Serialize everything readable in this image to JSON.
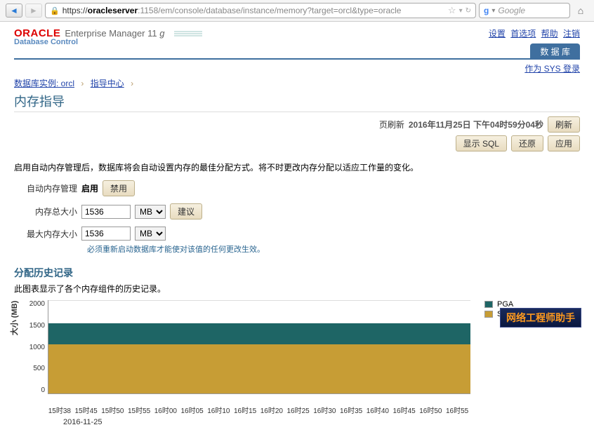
{
  "browser": {
    "url_prefix": "https://",
    "url_host": "oracleserver",
    "url_path": ":1158/em/console/database/instance/memory?target=orcl&type=oracle",
    "search_placeholder": "Google"
  },
  "header": {
    "logo": "ORACLE",
    "product": "Enterprise Manager 11",
    "product_suffix": "g",
    "subtitle": "Database Control",
    "links": [
      "设置",
      "首选项",
      "帮助",
      "注销"
    ],
    "tab_label": "数 据 库",
    "login_as": "作为 SYS 登录"
  },
  "breadcrumb": {
    "items": [
      "数据库实例: orcl",
      "指导中心"
    ]
  },
  "title": "内存指导",
  "refresh": {
    "label": "页刷新",
    "timestamp": "2016年11月25日  下午04时59分04秒",
    "btn_refresh": "刷新",
    "btn_sql": "显示 SQL",
    "btn_restore": "还原",
    "btn_apply": "应用"
  },
  "desc": "启用自动内存管理后，数据库将会自动设置内存的最佳分配方式。将不时更改内存分配以适应工作量的变化。",
  "form": {
    "auto_label": "自动内存管理",
    "auto_status": "启用",
    "btn_disable": "禁用",
    "total_label": "内存总大小",
    "total_value": "1536",
    "unit": "MB",
    "btn_advice": "建议",
    "max_label": "最大内存大小",
    "max_value": "1536",
    "tip": "必须重新启动数据库才能使对该值的任何更改生效。"
  },
  "section": {
    "heading": "分配历史记录",
    "sub": "此图表显示了各个内存组件的历史记录。"
  },
  "chart_data": {
    "type": "area",
    "title": "",
    "ylabel": "大小 (MB)",
    "ylim": [
      0,
      2000
    ],
    "yticks": [
      0,
      500,
      1000,
      1500,
      2000
    ],
    "categories": [
      "15时38",
      "15时45",
      "15时50",
      "15时55",
      "16时00",
      "16时05",
      "16时10",
      "16时15",
      "16时20",
      "16时25",
      "16时30",
      "16时35",
      "16时40",
      "16时45",
      "16时50",
      "16时55"
    ],
    "series": [
      {
        "name": "SGA",
        "values": [
          1050,
          1050,
          1050,
          1050,
          1050,
          1050,
          1050,
          1050,
          1050,
          1050,
          1050,
          1050,
          1050,
          1050,
          1050,
          1050
        ],
        "color": "#c79d35"
      },
      {
        "name": "PGA",
        "values": [
          450,
          450,
          450,
          450,
          450,
          450,
          450,
          450,
          450,
          450,
          450,
          450,
          450,
          450,
          450,
          450
        ],
        "color": "#1e6565"
      }
    ],
    "date_label": "2016-11-25",
    "legend": [
      "PGA",
      "SGA"
    ]
  },
  "watermark": "网络工程师助手"
}
